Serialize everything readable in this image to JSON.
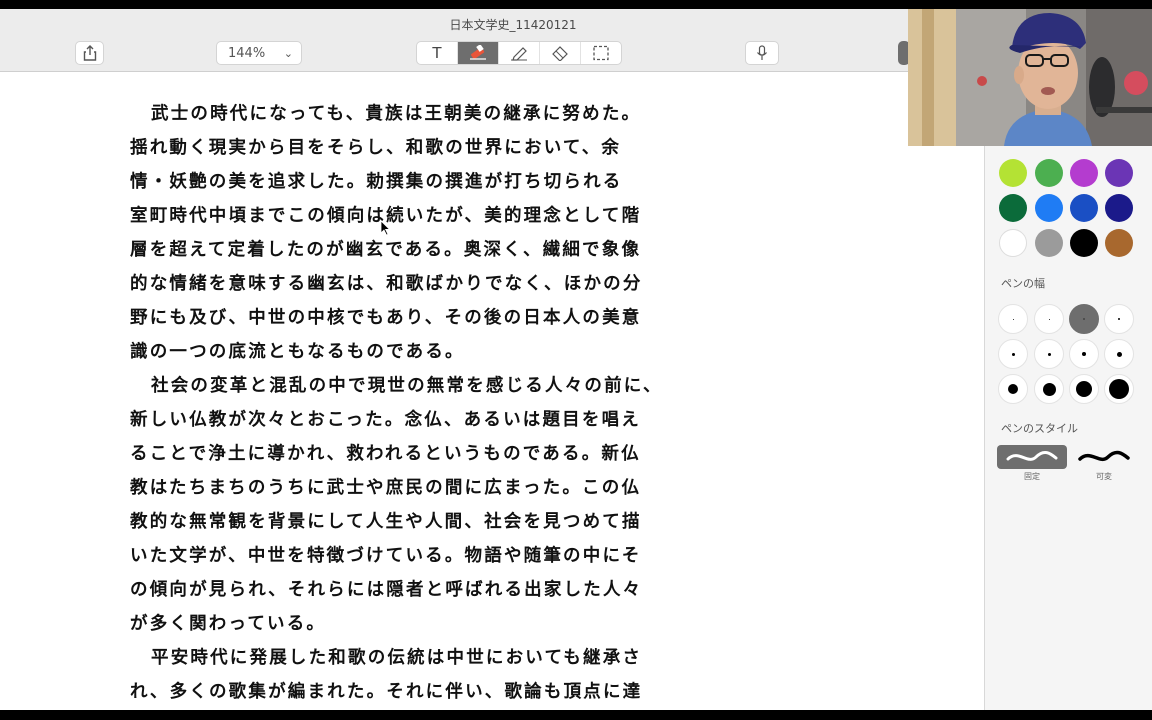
{
  "window": {
    "title": "日本文学史_11420121"
  },
  "toolbar": {
    "zoom": "144%",
    "tools": [
      {
        "name": "text-tool",
        "glyph": "T"
      },
      {
        "name": "highlighter-tool",
        "glyph": ""
      },
      {
        "name": "pen-tool",
        "glyph": ""
      },
      {
        "name": "eraser-tool",
        "glyph": ""
      },
      {
        "name": "lasso-select-tool",
        "glyph": ""
      }
    ],
    "icons": {
      "share": "share-icon",
      "microphone": "microphone-icon"
    }
  },
  "document": {
    "lines": [
      "武士の時代になっても、貴族は王朝美の継承に努めた。",
      "揺れ動く現実から目をそらし、和歌の世界において、余",
      "情・妖艶の美を追求した。勅撰集の撰進が打ち切られる",
      "室町時代中頃までこの傾向は続いたが、美的理念として階",
      "層を超えて定着したのが幽玄である。奥深く、繊細で象像",
      "的な情緒を意味する幽玄は、和歌ばかりでなく、ほかの分",
      "野にも及び、中世の中核でもあり、その後の日本人の美意",
      "識の一つの底流ともなるものである。",
      "社会の変革と混乱の中で現世の無常を感じる人々の前に、",
      "新しい仏教が次々とおこった。念仏、あるいは題目を唱え",
      "ることで浄土に導かれ、救われるというものである。新仏",
      "教はたちまちのうちに武士や庶民の間に広まった。この仏",
      "教的な無常観を背景にして人生や人間、社会を見つめて描",
      "いた文学が、中世を特徴づけている。物語や随筆の中にそ",
      "の傾向が見られ、それらには隠者と呼ばれる出家した人々",
      "が多く関わっている。",
      "平安時代に発展した和歌の伝統は中世においても継承さ",
      "れ、多くの歌集が編まれた。それに伴い、歌論も頂点に達"
    ]
  },
  "side_panel": {
    "colors": [
      "#b4e234",
      "#4caf50",
      "#b43ccf",
      "#6b35b5",
      "#0b6b3a",
      "#1f7cf4",
      "#1a4fc4",
      "#1b1a8a",
      "#ffffff",
      "#9b9b9b",
      "#000000",
      "#a8682e"
    ],
    "partial_colors": [
      "#f0d53c",
      "#f5a623",
      "#e8553a",
      "#e84a9a"
    ],
    "width_label": "ペンの幅",
    "style_label": "ペンのスタイル",
    "styles": [
      {
        "caption": "固定",
        "selected": true
      },
      {
        "caption": "可変",
        "selected": false
      }
    ]
  }
}
